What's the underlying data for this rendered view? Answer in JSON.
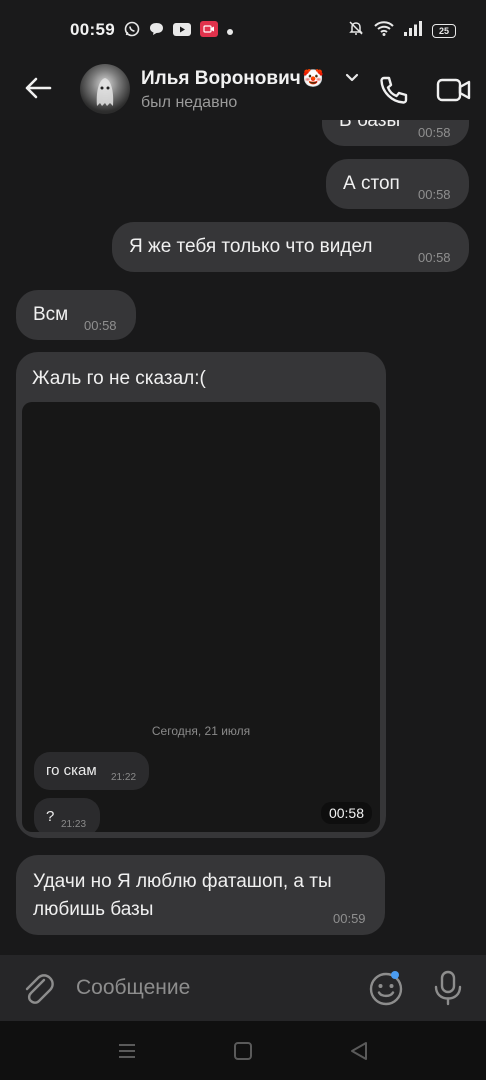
{
  "status_bar": {
    "time": "00:59",
    "battery": "25",
    "left_icons": [
      "whatsapp-icon",
      "message-icon",
      "youtube-icon",
      "screen-record-icon",
      "dot-icon"
    ],
    "right_icons": [
      "mute-icon",
      "wifi-icon",
      "signal-icon",
      "battery-icon"
    ]
  },
  "header": {
    "contact_name": "Илья Воронович",
    "contact_emoji": "🤡",
    "contact_status": "был недавно",
    "icons": [
      "back-arrow-icon",
      "chevron-down-icon",
      "phone-icon",
      "video-camera-icon"
    ]
  },
  "messages": [
    {
      "direction": "outgoing",
      "text": "В базы",
      "time": "00:58"
    },
    {
      "direction": "outgoing",
      "text": "А стоп",
      "time": "00:58"
    },
    {
      "direction": "outgoing",
      "text": "Я же тебя только что видел",
      "time": "00:58"
    },
    {
      "direction": "incoming",
      "text": "Всм",
      "time": "00:58"
    },
    {
      "direction": "incoming",
      "text": "Жаль го не сказал:(",
      "video": {
        "date_label": "Сегодня, 21 июля",
        "inner_messages": [
          {
            "text": "го скам",
            "time": "21:22"
          },
          {
            "text": "?",
            "time": "21:23"
          }
        ],
        "duration": "00:58"
      }
    },
    {
      "direction": "incoming",
      "text_line1": "Удачи но Я люблю фаташоп, а ты",
      "text_line2": "любишь базы",
      "time": "00:59"
    }
  ],
  "input": {
    "placeholder": "Сообщение",
    "icons": [
      "paperclip-icon",
      "emoji-icon",
      "microphone-icon"
    ],
    "notification_dot_color": "#4b9cf0"
  },
  "nav": {
    "icons": [
      "menu-icon",
      "home-icon",
      "back-icon"
    ]
  },
  "colors": {
    "background": "#19191a",
    "bubble": "#363638",
    "input_bar": "#262628",
    "accent": "#4b9cf0"
  }
}
